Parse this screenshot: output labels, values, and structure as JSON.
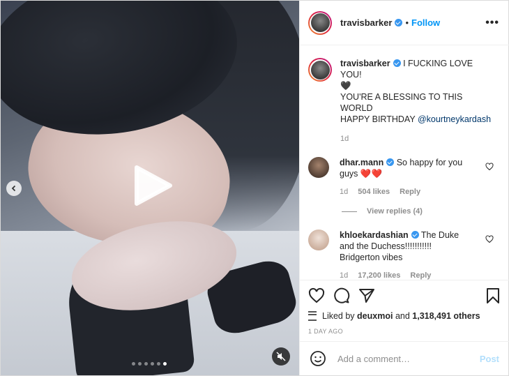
{
  "header": {
    "username": "travisbarker",
    "bullet": "•",
    "follow_label": "Follow",
    "more_label": "•••"
  },
  "caption": {
    "username": "travisbarker",
    "line1": "I FUCKING LOVE YOU!",
    "emoji": "🖤",
    "line2": "YOU'RE A BLESSING TO THIS WORLD",
    "line3": "HAPPY BIRTHDAY",
    "mention": "@kourtneykardash",
    "age": "1d"
  },
  "comments": [
    {
      "username": "dhar.mann",
      "text": "So happy for you guys",
      "emoji": "❤️❤️",
      "age": "1d",
      "likes": "504 likes",
      "reply_label": "Reply",
      "view_replies": "View replies (4)",
      "avatar_color": "#6b5a4e"
    },
    {
      "username": "khloekardashian",
      "text": "The Duke and the Duchess!!!!!!!!!!! Bridgerton vibes",
      "age": "1d",
      "likes": "17,200 likes",
      "reply_label": "Reply",
      "avatar_color": "#d8c2b6"
    }
  ],
  "likes": {
    "prefix": "Liked by",
    "user": "deuxmoi",
    "conjunction": "and",
    "count": "1,318,491 others"
  },
  "timestamp": "1 DAY AGO",
  "composer": {
    "placeholder": "Add a comment…",
    "post_label": "Post"
  },
  "media": {
    "slide_count": 6,
    "active_slide": 6
  },
  "colors": {
    "accent": "#0095f6",
    "verified": "#3897f0",
    "muted_text": "#8e8e8e",
    "post_disabled": "#b2dffc"
  }
}
